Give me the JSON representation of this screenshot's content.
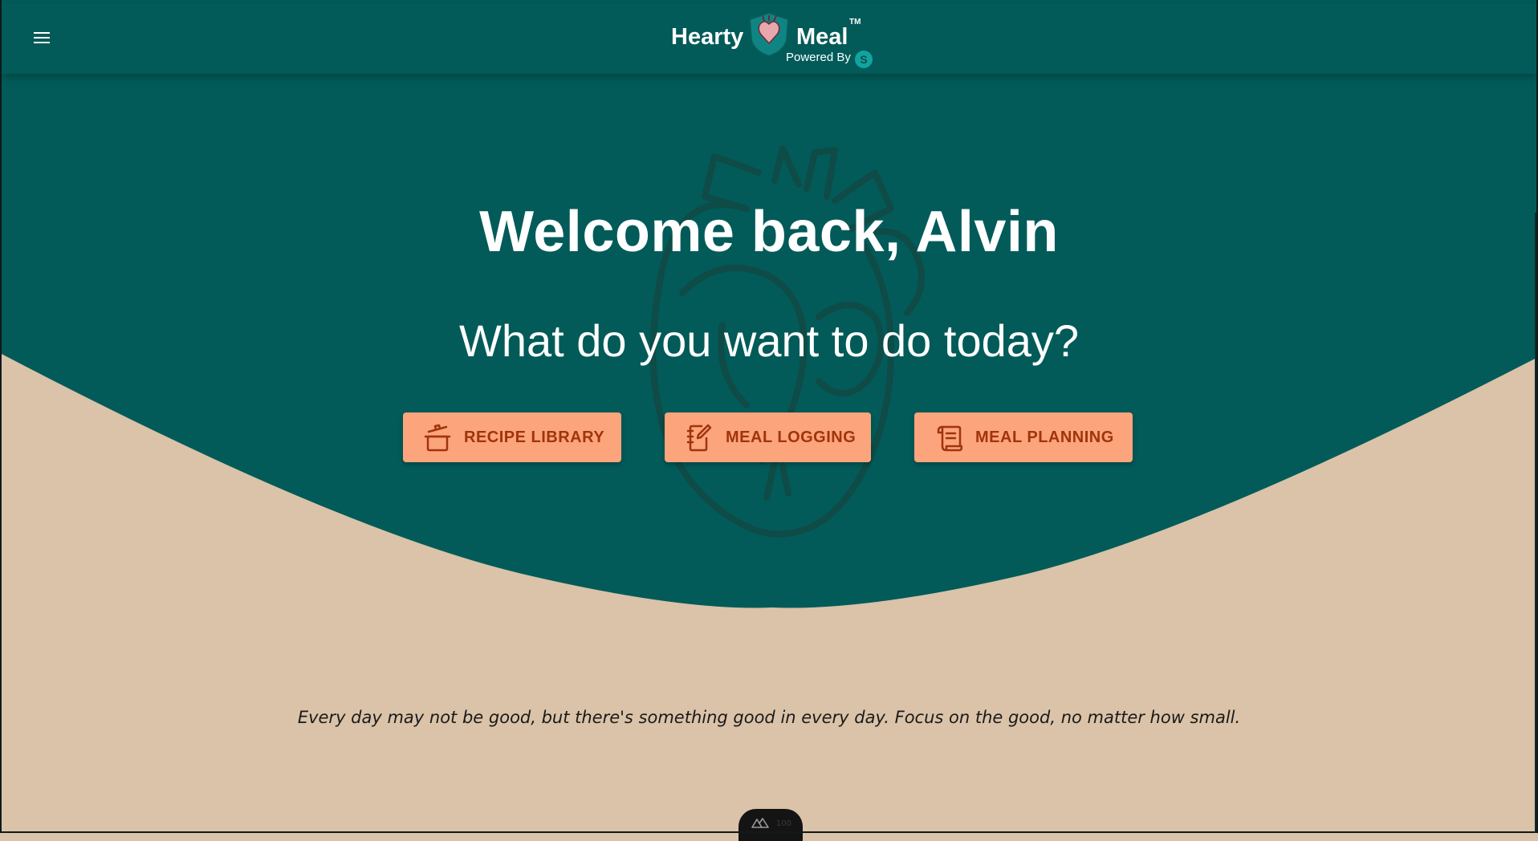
{
  "header": {
    "menu_icon": "hamburger-menu-icon",
    "logo": {
      "brand_left": "Hearty",
      "brand_right": "Meal",
      "trademark": "TM",
      "powered_by": "Powered By",
      "badge_icon": "heart-shield-icon",
      "partner_icon": "s-circle-icon"
    }
  },
  "hero": {
    "greeting": "Welcome back, Alvin",
    "prompt": "What do you want to do today?",
    "background_icon": "anatomical-heart-icon",
    "actions": [
      {
        "label": "RECIPE LIBRARY",
        "icon": "cooking-pot-icon"
      },
      {
        "label": "MEAL LOGGING",
        "icon": "notebook-pen-icon"
      },
      {
        "label": "MEAL PLANNING",
        "icon": "scroll-list-icon"
      }
    ]
  },
  "quote": "Every day may not be good, but there's something good in every day. Focus on the good, no matter how small.",
  "devtools": {
    "icon": "nuxt-logo-icon",
    "count": "100"
  },
  "colors": {
    "header_bg": "#025b59",
    "hero_bg": "#025b59",
    "page_bg": "#dac3a8",
    "button_bg": "#fca47c",
    "button_text": "#a0340c",
    "heart_outline": "#0f4b47"
  }
}
